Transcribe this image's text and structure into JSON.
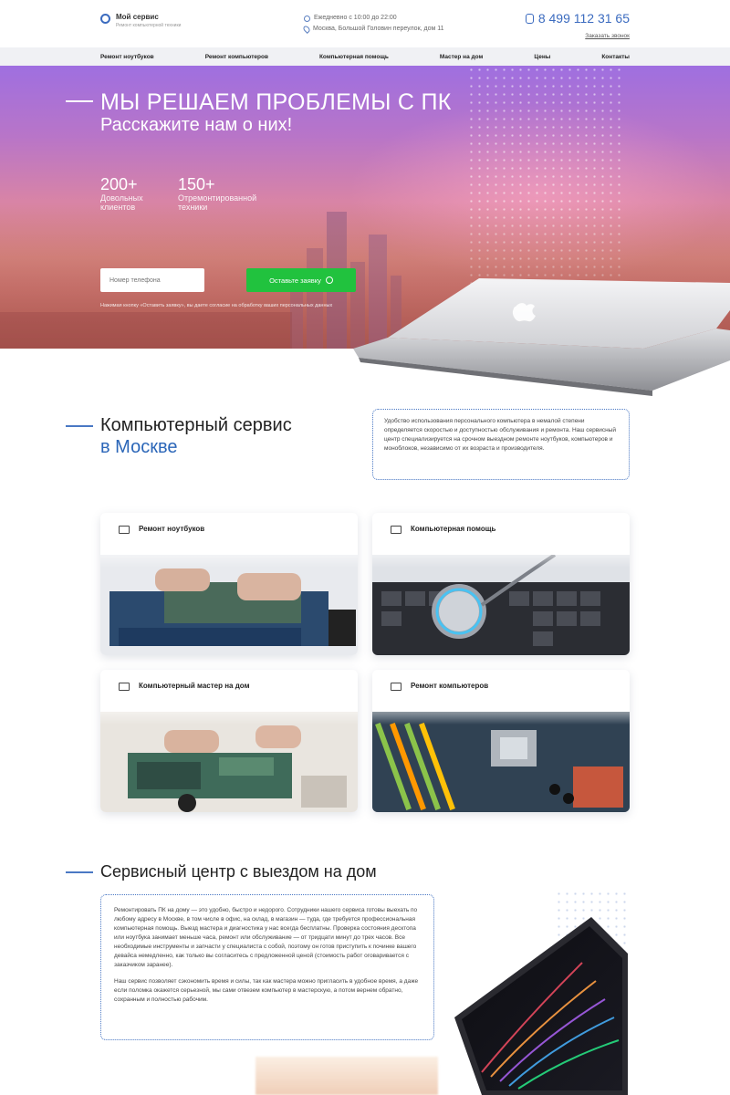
{
  "header": {
    "logo_name": "Мой сервис",
    "logo_sub": "Ремонт компьютерной техники",
    "hours": "Ежедневно с 10:00 до 22:00",
    "address": "Москва, Большой Головин переулок, дом 11",
    "phone": "8 499 112 31 65",
    "callback": "Заказать звонок"
  },
  "nav": {
    "items": [
      "Ремонт ноутбуков",
      "Ремонт компьютеров",
      "Компьютерная помощь",
      "Мастер на дом",
      "Цены",
      "Контакты"
    ]
  },
  "hero": {
    "title": "МЫ РЕШАЕМ ПРОБЛЕМЫ С ПК",
    "subtitle": "Расскажите нам о них!",
    "stats": [
      {
        "num": "200+",
        "label": "Довольных клиентов"
      },
      {
        "num": "150+",
        "label": "Отремонтированной техники"
      }
    ],
    "phone_placeholder": "Номер телефона",
    "submit_label": "Оставьте заявку",
    "consent": "Нажимая кнопку «Оставить заявку», вы даете согласие на обработку ваших персональных данных"
  },
  "service": {
    "title_line1": "Компьютерный сервис",
    "title_line2": "в Москве",
    "description": "Удобство использования персонального компьютера в немалой степени определяется скоростью и доступностью обслуживания и ремонта. Наш сервисный центр специализируется на срочном выездном ремонте ноутбуков, компьютеров и моноблоков, независимо от их возраста и производителя."
  },
  "cards": [
    {
      "title": "Ремонт ноутбуков",
      "icon": "laptop-icon"
    },
    {
      "title": "Компьютерная помощь",
      "icon": "support-icon"
    },
    {
      "title": "Компьютерный мастер на дом",
      "icon": "car-icon"
    },
    {
      "title": "Ремонт компьютеров",
      "icon": "desktop-icon"
    }
  ],
  "home_service": {
    "title": "Сервисный центр с выездом на дом",
    "paragraph1": "Ремонтировать ПК на дому — это удобно, быстро и недорого. Сотрудники нашего сервиса готовы выехать по любому адресу в Москве, в том числе в офис, на склад, в магазин — туда, где требуется профессиональная компьютерная помощь. Выезд мастера и диагностика у нас всегда бесплатны. Проверка состояния десктопа или ноутбука занимает меньше часа, ремонт или обслуживание — от тридцати минут до трех часов. Все необходимые инструменты и запчасти у специалиста с собой, поэтому он готов приступить к починке вашего девайса немедленно, как только вы согласитесь с предложенной ценой (стоимость работ оговаривается с заказчиком заранее).",
    "paragraph2": "Наш сервис позволяет сэкономить время и силы, так как мастера можно пригласить в удобное время, а даже если поломка окажется серьезной, мы сами отвезем компьютер в мастерскую, а потом вернем обратно, сохранным и полностью рабочим."
  },
  "colors": {
    "accent": "#2b66b8",
    "button_green": "#21c23e",
    "nav_bg": "#f0f1f4"
  }
}
